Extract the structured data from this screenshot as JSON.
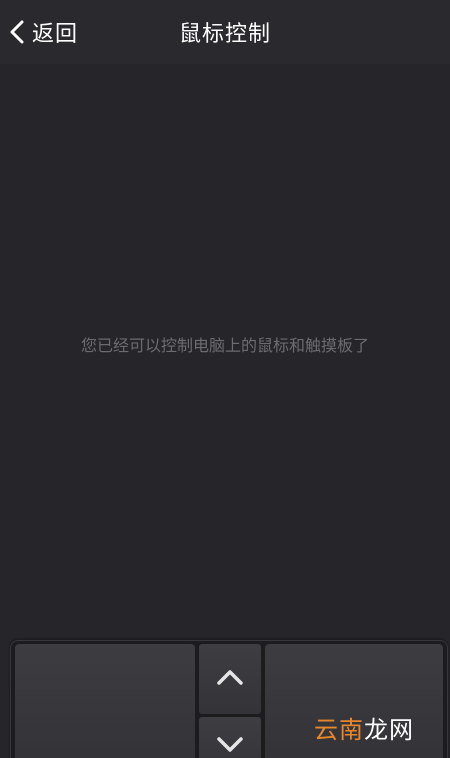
{
  "nav": {
    "back_label": "返回",
    "title": "鼠标控制"
  },
  "touchpad": {
    "hint": "您已经可以控制电脑上的鼠标和触摸板了"
  },
  "watermark": {
    "part1": "云南",
    "part2": "龙网"
  },
  "colors": {
    "background": "#26262a",
    "nav_background": "#2a2a2e",
    "hint_text": "#6b6b70",
    "watermark_accent": "#e8862c"
  }
}
